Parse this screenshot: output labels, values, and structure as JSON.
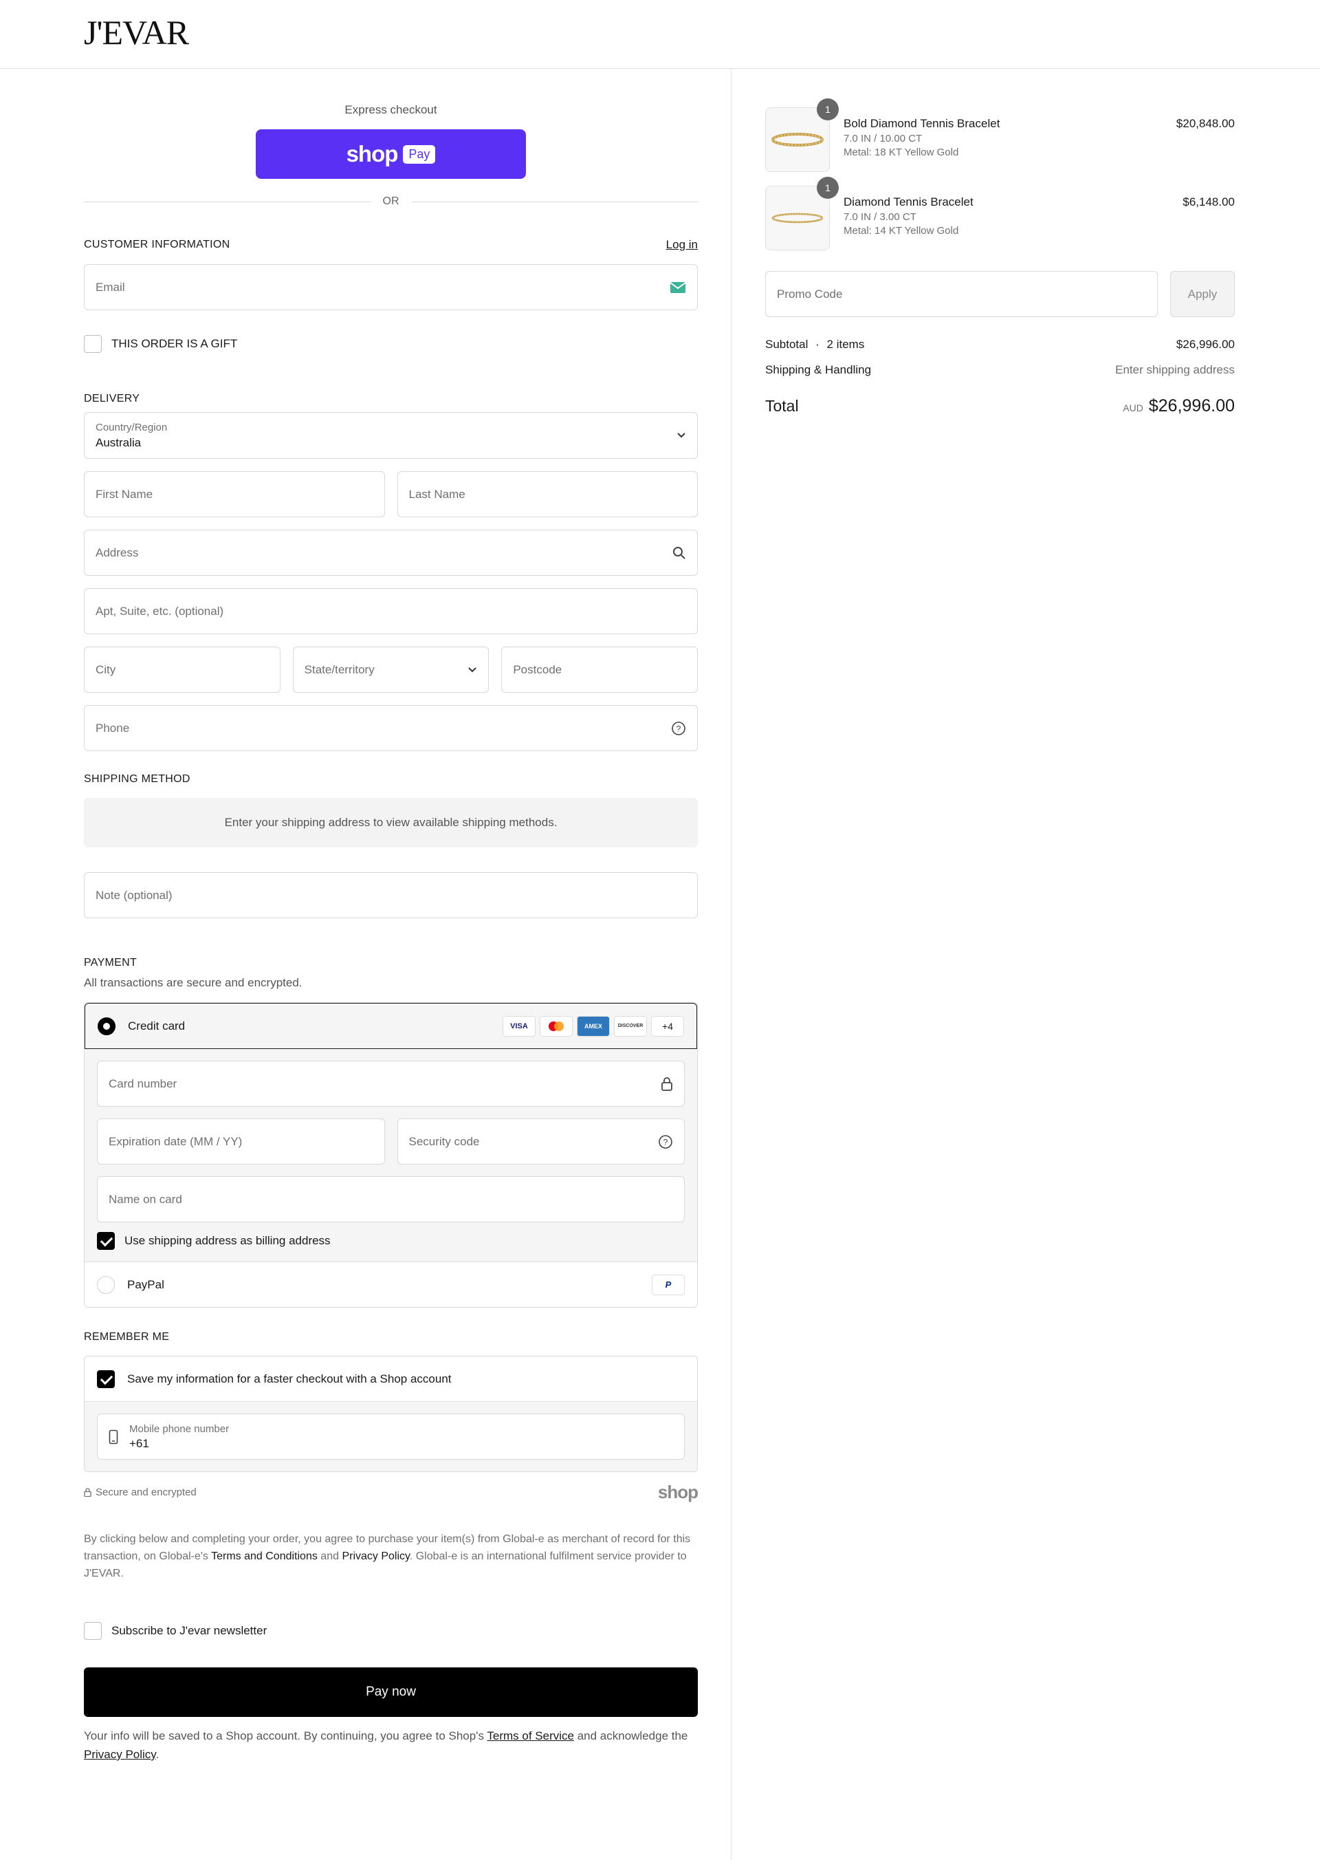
{
  "header": {
    "logo": "J'EVAR"
  },
  "express": {
    "label": "Express checkout",
    "shop": "shop",
    "pay": "Pay",
    "or": "OR"
  },
  "customer": {
    "title": "CUSTOMER INFORMATION",
    "login": "Log in",
    "email_placeholder": "Email",
    "gift": "THIS ORDER IS A GIFT"
  },
  "delivery": {
    "title": "DELIVERY",
    "country_label": "Country/Region",
    "country_value": "Australia",
    "first_name": "First Name",
    "last_name": "Last Name",
    "address": "Address",
    "apt": "Apt, Suite, etc. (optional)",
    "city": "City",
    "state": "State/territory",
    "postcode": "Postcode",
    "phone": "Phone"
  },
  "shipping": {
    "title": "SHIPPING METHOD",
    "message": "Enter your shipping address to view available shipping methods.",
    "note": "Note (optional)"
  },
  "payment": {
    "title": "PAYMENT",
    "subtitle": "All transactions are secure and encrypted.",
    "credit_card": "Credit card",
    "cards": [
      "VISA",
      "MC",
      "AMEX",
      "DISCOVER"
    ],
    "more_cards": "+4",
    "card_number": "Card number",
    "expiration": "Expiration date (MM / YY)",
    "security": "Security code",
    "name_on_card": "Name on card",
    "billing_same": "Use shipping address as billing address",
    "paypal": "PayPal"
  },
  "remember": {
    "title": "REMEMBER ME",
    "save": "Save my information for a faster checkout with a Shop account",
    "phone_label": "Mobile phone number",
    "phone_value": "+61",
    "secure": "Secure and encrypted",
    "shop": "shop"
  },
  "legal": {
    "p1": "By clicking below and completing your order, you agree to purchase your item(s) from Global-e as merchant of record for this transaction, on Global-e's",
    "terms": "Terms and Conditions",
    "and": "and",
    "privacy": "Privacy Policy",
    "p2": ". Global-e is an international fulfilment service provider to J'EVAR."
  },
  "newsletter": "Subscribe to J'evar newsletter",
  "pay_now": "Pay now",
  "footer_note": {
    "p1": "Your info will be saved to a Shop account. By continuing, you agree to Shop's",
    "tos": "Terms of Service",
    "p2": "and acknowledge the",
    "privacy": "Privacy Policy",
    "p3": "."
  },
  "summary": {
    "items": [
      {
        "qty": "1",
        "name": "Bold Diamond Tennis Bracelet",
        "size": "7.0 IN / 10.00 CT",
        "metal": "Metal: 18 KT Yellow Gold",
        "price": "$20,848.00"
      },
      {
        "qty": "1",
        "name": "Diamond Tennis Bracelet",
        "size": "7.0 IN / 3.00 CT",
        "metal": "Metal: 14 KT Yellow Gold",
        "price": "$6,148.00"
      }
    ],
    "promo_placeholder": "Promo Code",
    "apply": "Apply",
    "subtotal_label": "Subtotal",
    "item_count": "2 items",
    "subtotal": "$26,996.00",
    "shipping_label": "Shipping & Handling",
    "shipping_value": "Enter shipping address",
    "total_label": "Total",
    "currency": "AUD",
    "total": "$26,996.00"
  }
}
